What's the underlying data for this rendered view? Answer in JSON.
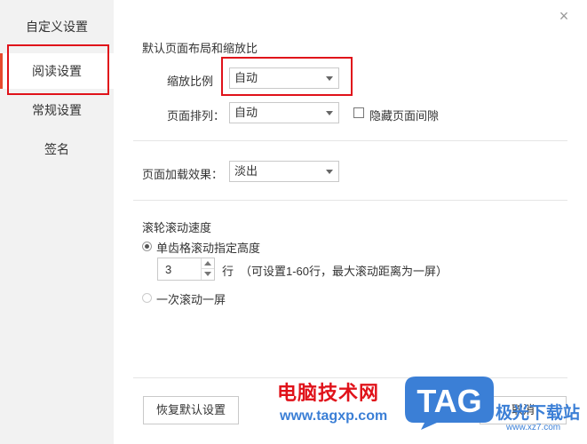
{
  "sidebar": {
    "title": "自定义设置",
    "items": [
      {
        "label": "阅读设置",
        "active": true
      },
      {
        "label": "常规设置",
        "active": false
      },
      {
        "label": "签名",
        "active": false
      }
    ]
  },
  "close_glyph": "×",
  "section_layout": {
    "heading": "默认页面布局和缩放比",
    "zoom_label": "缩放比例",
    "zoom_value": "自动",
    "arrange_label": "页面排列：",
    "arrange_value": "自动",
    "hide_gap_label": "隐藏页面间隙",
    "hide_gap_checked": false
  },
  "section_load": {
    "label": "页面加载效果：",
    "value": "淡出"
  },
  "section_scroll": {
    "heading": "滚轮滚动速度",
    "option1_label": "单齿格滚动指定高度",
    "option1_selected": true,
    "rows_value": "3",
    "rows_unit": "行",
    "rows_hint": "（可设置1-60行，最大滚动距离为一屏）",
    "option2_label": "一次滚动一屏",
    "option2_selected": false
  },
  "footer": {
    "restore_label": "恢复默认设置",
    "cancel_label": "取消"
  },
  "watermark": {
    "site_cn": "电脑技术网",
    "site_url": "www.tagxp.com",
    "logo_text": "TAG",
    "right_cn": "极光下载站",
    "right_url": "www.xz7.com"
  },
  "colors": {
    "highlight_box": "#e0121a",
    "active_indicator": "#e64a2e",
    "sidebar_bg": "#f2f2f2",
    "logo_blue": "#3b7fd6"
  },
  "icons": {
    "close": "close-icon",
    "dropdown": "chevron-down-icon",
    "spin_up": "arrow-up-icon",
    "spin_down": "arrow-down-icon"
  }
}
